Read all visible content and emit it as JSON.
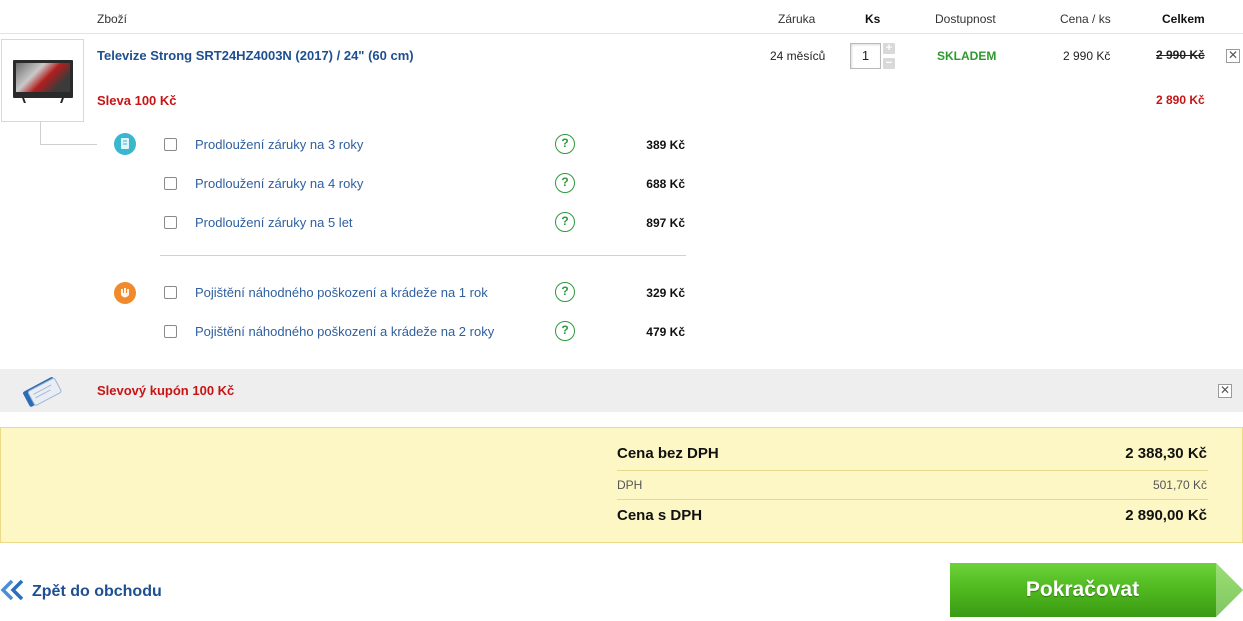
{
  "header": {
    "col_product": "Zboží",
    "col_warranty": "Záruka",
    "col_qty": "Ks",
    "col_availability": "Dostupnost",
    "col_unit_price": "Cena / ks",
    "col_total": "Celkem"
  },
  "product": {
    "name": "Televize Strong SRT24HZ4003N (2017) / 24\" (60 cm)",
    "warranty": "24 měsíců",
    "quantity": "1",
    "availability": "SKLADEM",
    "unit_price": "2 990 Kč",
    "total_old": "2 990 Kč",
    "discount_label": "Sleva 100 Kč",
    "total_new": "2 890 Kč",
    "qty_plus": "+",
    "qty_minus": "−",
    "remove_symbol": "✕"
  },
  "warranty_options": [
    {
      "label": "Prodloužení záruky na 3 roky",
      "price": "389 Kč"
    },
    {
      "label": "Prodloužení záruky na 4 roky",
      "price": "688 Kč"
    },
    {
      "label": "Prodloužení záruky na 5 let",
      "price": "897 Kč"
    }
  ],
  "insurance_options": [
    {
      "label": "Pojištění náhodného poškození a krádeže na 1 rok",
      "price": "329 Kč"
    },
    {
      "label": "Pojištění náhodného poškození a krádeže na 2 roky",
      "price": "479 Kč"
    }
  ],
  "help_symbol": "?",
  "coupon": {
    "label": "Slevový kupón 100 Kč",
    "remove_symbol": "✕"
  },
  "summary": {
    "without_vat_label": "Cena bez DPH",
    "without_vat_value": "2 388,30 Kč",
    "vat_label": "DPH",
    "vat_value": "501,70 Kč",
    "with_vat_label": "Cena s DPH",
    "with_vat_value": "2 890,00 Kč"
  },
  "footer": {
    "back_label": "Zpět do obchodu",
    "continue_label": "Pokračovat"
  },
  "colors": {
    "link_blue": "#1d4f91",
    "discount_red": "#c81414",
    "stock_green": "#2d9a2d",
    "continue_green": "#4fb81f",
    "summary_bg": "#fdf7c5"
  },
  "icons": {
    "warranty_category": "warranty-shield-icon",
    "insurance_category": "insurance-hand-icon",
    "coupon": "coupon-ticket-icon",
    "back": "double-chevron-left-icon"
  }
}
